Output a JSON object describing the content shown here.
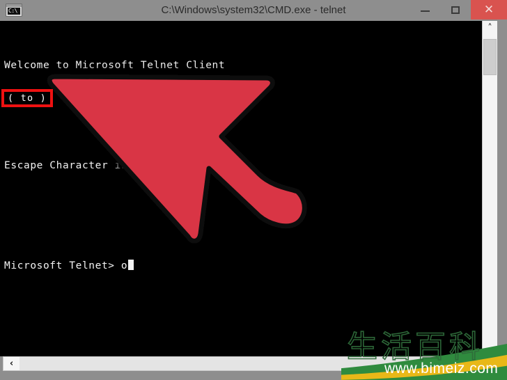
{
  "window": {
    "title": "C:\\Windows\\system32\\CMD.exe - telnet",
    "icon_name": "cmd-console-icon",
    "icon_text": "C:\\",
    "titlebar_color": "#8e8e8e",
    "controls": {
      "minimize_label": "—",
      "maximize_label": "□",
      "close_label": "✕",
      "close_color": "#d9534f"
    }
  },
  "console": {
    "background": "#000000",
    "foreground": "#f2f2f2",
    "lines": [
      "Welcome to Microsoft Telnet Client",
      "",
      "Escape Character is 'CTRL+]'",
      "",
      "Microsoft Telnet> o"
    ],
    "highlight": {
      "text": "( to )",
      "border_color": "#ee1111"
    }
  },
  "cursor_annotation": {
    "name": "red-arrow-pointer",
    "fill": "#d93544",
    "outline": "#000000",
    "glow": "#000000"
  },
  "scrollbars": {
    "vertical": {
      "up_arrow_label": "˄",
      "thumb_position": "top"
    },
    "horizontal": {
      "left_arrow_label": "‹"
    }
  },
  "watermark": {
    "chinese_text": "生活百科",
    "url": "www.bimeiz.com",
    "stroke_color": "#2f6b3a",
    "swoosh_green": "#2f8b3e",
    "swoosh_yellow": "#e8b818"
  }
}
